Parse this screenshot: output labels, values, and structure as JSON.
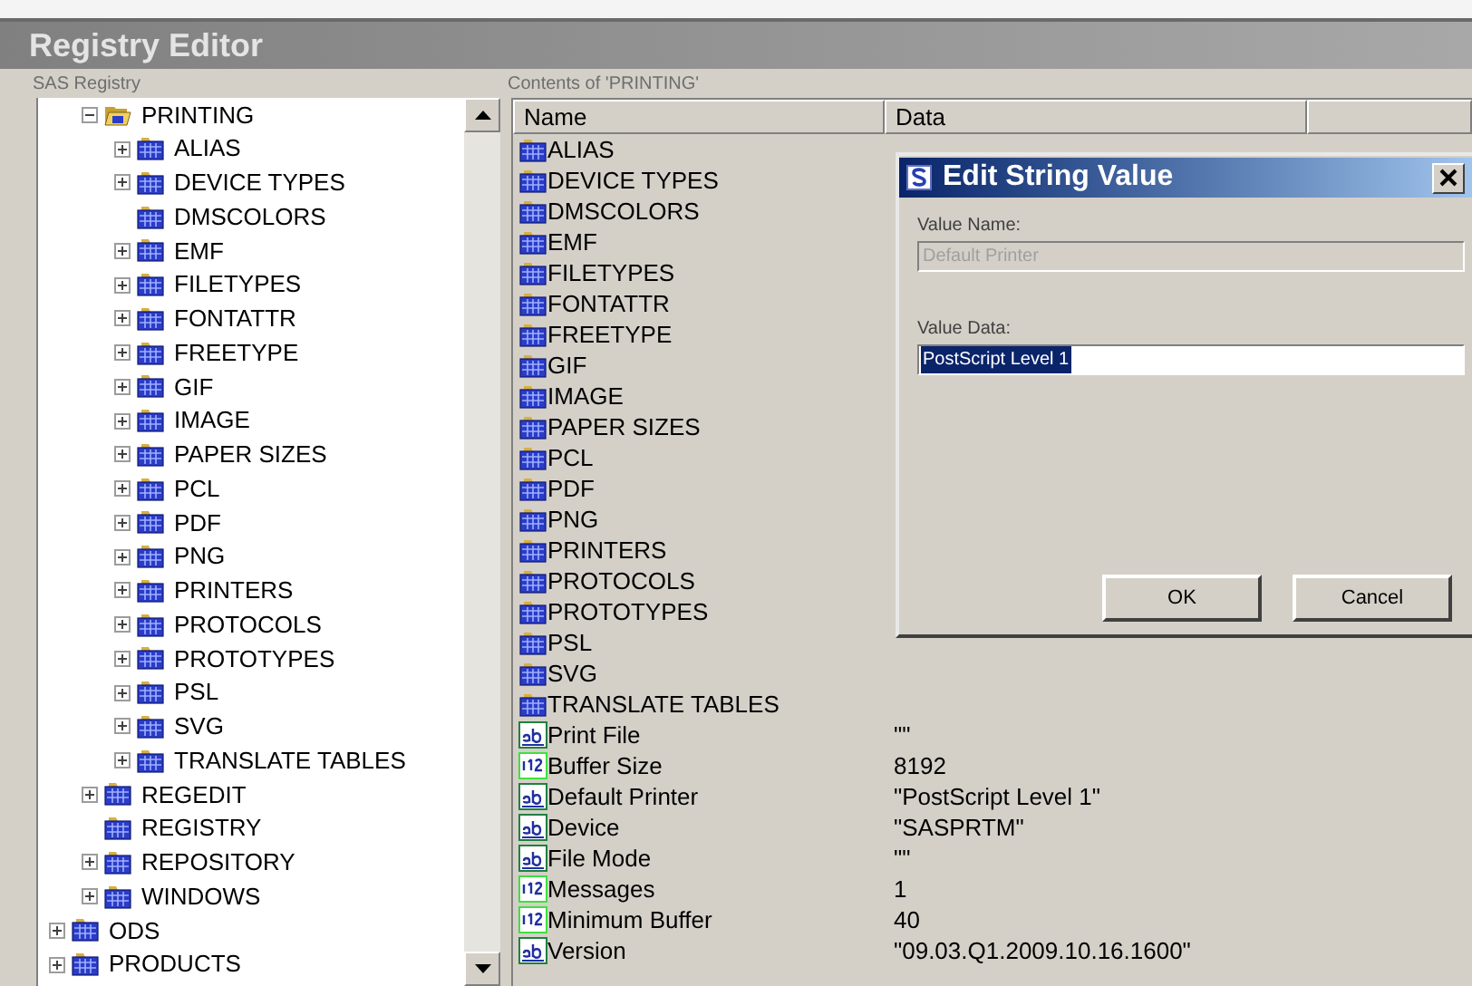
{
  "window": {
    "title": "Registry Editor"
  },
  "tree": {
    "label": "SAS Registry",
    "items": [
      {
        "children": [
          {
            "label": "PRINTING",
            "expanded": true,
            "children": [
              {
                "label": "ALIAS",
                "expanded": false
              },
              {
                "label": "DEVICE TYPES",
                "expanded": false
              },
              {
                "label": "DMSCOLORS"
              },
              {
                "label": "EMF",
                "expanded": false
              },
              {
                "label": "FILETYPES",
                "expanded": false
              },
              {
                "label": "FONTATTR",
                "expanded": false
              },
              {
                "label": "FREETYPE",
                "expanded": false
              },
              {
                "label": "GIF",
                "expanded": false
              },
              {
                "label": "IMAGE",
                "expanded": false
              },
              {
                "label": "PAPER SIZES",
                "expanded": false
              },
              {
                "label": "PCL",
                "expanded": false
              },
              {
                "label": "PDF",
                "expanded": false
              },
              {
                "label": "PNG",
                "expanded": false
              },
              {
                "label": "PRINTERS",
                "expanded": false
              },
              {
                "label": "PROTOCOLS",
                "expanded": false
              },
              {
                "label": "PROTOTYPES",
                "expanded": false
              },
              {
                "label": "PSL",
                "expanded": false
              },
              {
                "label": "SVG",
                "expanded": false
              },
              {
                "label": "TRANSLATE TABLES",
                "expanded": false
              }
            ]
          },
          {
            "label": "REGEDIT",
            "expanded": false
          },
          {
            "label": "REGISTRY"
          },
          {
            "label": "REPOSITORY",
            "expanded": false
          },
          {
            "label": "WINDOWS",
            "expanded": false
          }
        ]
      },
      {
        "label": "ODS",
        "expanded": false
      },
      {
        "label": "PRODUCTS",
        "expanded": false
      }
    ]
  },
  "list": {
    "label": "Contents of 'PRINTING'",
    "columns": [
      "Name",
      "Data"
    ],
    "rows": [
      {
        "kind": "key",
        "name": "ALIAS"
      },
      {
        "kind": "key",
        "name": "DEVICE TYPES"
      },
      {
        "kind": "key",
        "name": "DMSCOLORS"
      },
      {
        "kind": "key",
        "name": "EMF"
      },
      {
        "kind": "key",
        "name": "FILETYPES"
      },
      {
        "kind": "key",
        "name": "FONTATTR"
      },
      {
        "kind": "key",
        "name": "FREETYPE"
      },
      {
        "kind": "key",
        "name": "GIF"
      },
      {
        "kind": "key",
        "name": "IMAGE"
      },
      {
        "kind": "key",
        "name": "PAPER SIZES"
      },
      {
        "kind": "key",
        "name": "PCL"
      },
      {
        "kind": "key",
        "name": "PDF"
      },
      {
        "kind": "key",
        "name": "PNG"
      },
      {
        "kind": "key",
        "name": "PRINTERS"
      },
      {
        "kind": "key",
        "name": "PROTOCOLS"
      },
      {
        "kind": "key",
        "name": "PROTOTYPES"
      },
      {
        "kind": "key",
        "name": "PSL"
      },
      {
        "kind": "key",
        "name": "SVG"
      },
      {
        "kind": "key",
        "name": "TRANSLATE TABLES"
      },
      {
        "kind": "string",
        "name": "Print File",
        "data": "\"\""
      },
      {
        "kind": "number",
        "name": "Buffer Size",
        "data": "8192"
      },
      {
        "kind": "string",
        "name": "Default Printer",
        "data": "\"PostScript Level 1\""
      },
      {
        "kind": "string",
        "name": "Device",
        "data": "\"SASPRTM\""
      },
      {
        "kind": "string",
        "name": "File Mode",
        "data": "\"\""
      },
      {
        "kind": "number",
        "name": "Messages",
        "data": "1"
      },
      {
        "kind": "number",
        "name": "Minimum Buffer",
        "data": "40"
      },
      {
        "kind": "string",
        "name": "Version",
        "data": "\"09.03.Q1.2009.10.16.1600\""
      }
    ]
  },
  "dialog": {
    "title": "Edit String Value",
    "value_name": {
      "label": "Value Name:",
      "value": "Default Printer",
      "disabled": true
    },
    "value_data": {
      "label": "Value Data:",
      "value": "PostScript Level 1",
      "selected": true
    },
    "buttons": [
      "OK",
      "Cancel"
    ]
  }
}
